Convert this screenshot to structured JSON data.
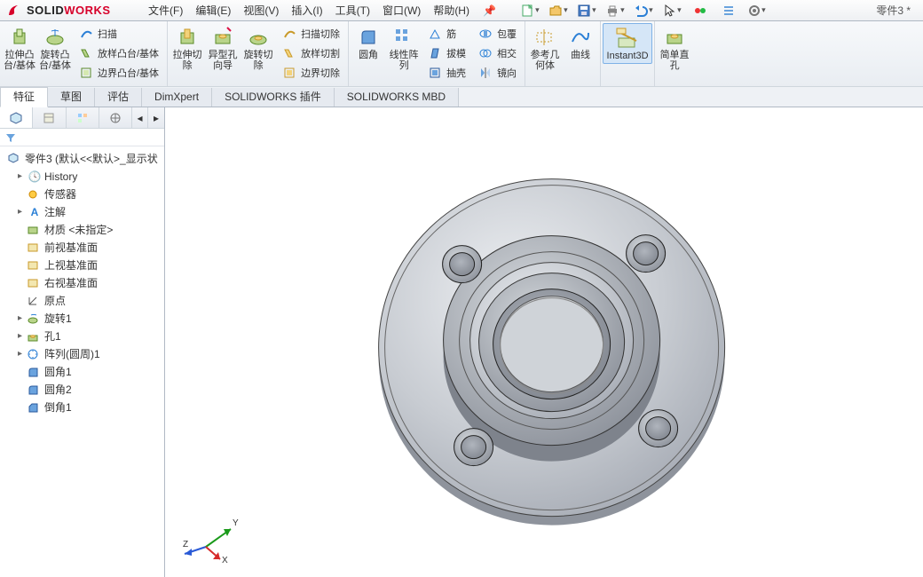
{
  "app": {
    "brand_solid": "SOLID",
    "brand_works": "WORKS",
    "doc_title": "零件3 *"
  },
  "menu": {
    "file": "文件(F)",
    "edit": "编辑(E)",
    "view": "视图(V)",
    "insert": "插入(I)",
    "tools": "工具(T)",
    "window": "窗口(W)",
    "help": "帮助(H)"
  },
  "ribbon": {
    "g1_big1": "拉伸凸台/基体",
    "g1_big2": "旋转凸台/基体",
    "g1_m1": "扫描",
    "g1_m2": "放样凸台/基体",
    "g1_m3": "边界凸台/基体",
    "g2_big1": "拉伸切除",
    "g2_big2": "异型孔向导",
    "g2_big3": "旋转切除",
    "g2_m1": "扫描切除",
    "g2_m2": "放样切割",
    "g2_m3": "边界切除",
    "g3_big1": "圆角",
    "g3_big2": "线性阵列",
    "g3_m1": "筋",
    "g3_m2": "拔模",
    "g3_m3": "抽壳",
    "g3_m4": "包覆",
    "g3_m5": "相交",
    "g3_m6": "镜向",
    "g4_big1": "参考几何体",
    "g4_big2": "曲线",
    "g5_big1": "Instant3D",
    "g6_big1": "简单直孔"
  },
  "tabs": {
    "t1": "特征",
    "t2": "草图",
    "t3": "评估",
    "t4": "DimXpert",
    "t5": "SOLIDWORKS 插件",
    "t6": "SOLIDWORKS MBD"
  },
  "tree": {
    "root": "零件3  (默认<<默认>_显示状",
    "n1": "History",
    "n2": "传感器",
    "n3": "注解",
    "n4": "材质 <未指定>",
    "n5": "前视基准面",
    "n6": "上视基准面",
    "n7": "右视基准面",
    "n8": "原点",
    "n9": "旋转1",
    "n10": "孔1",
    "n11": "阵列(圆周)1",
    "n12": "圆角1",
    "n13": "圆角2",
    "n14": "倒角1"
  },
  "triad": {
    "x": "X",
    "y": "Y",
    "z": "Z"
  }
}
